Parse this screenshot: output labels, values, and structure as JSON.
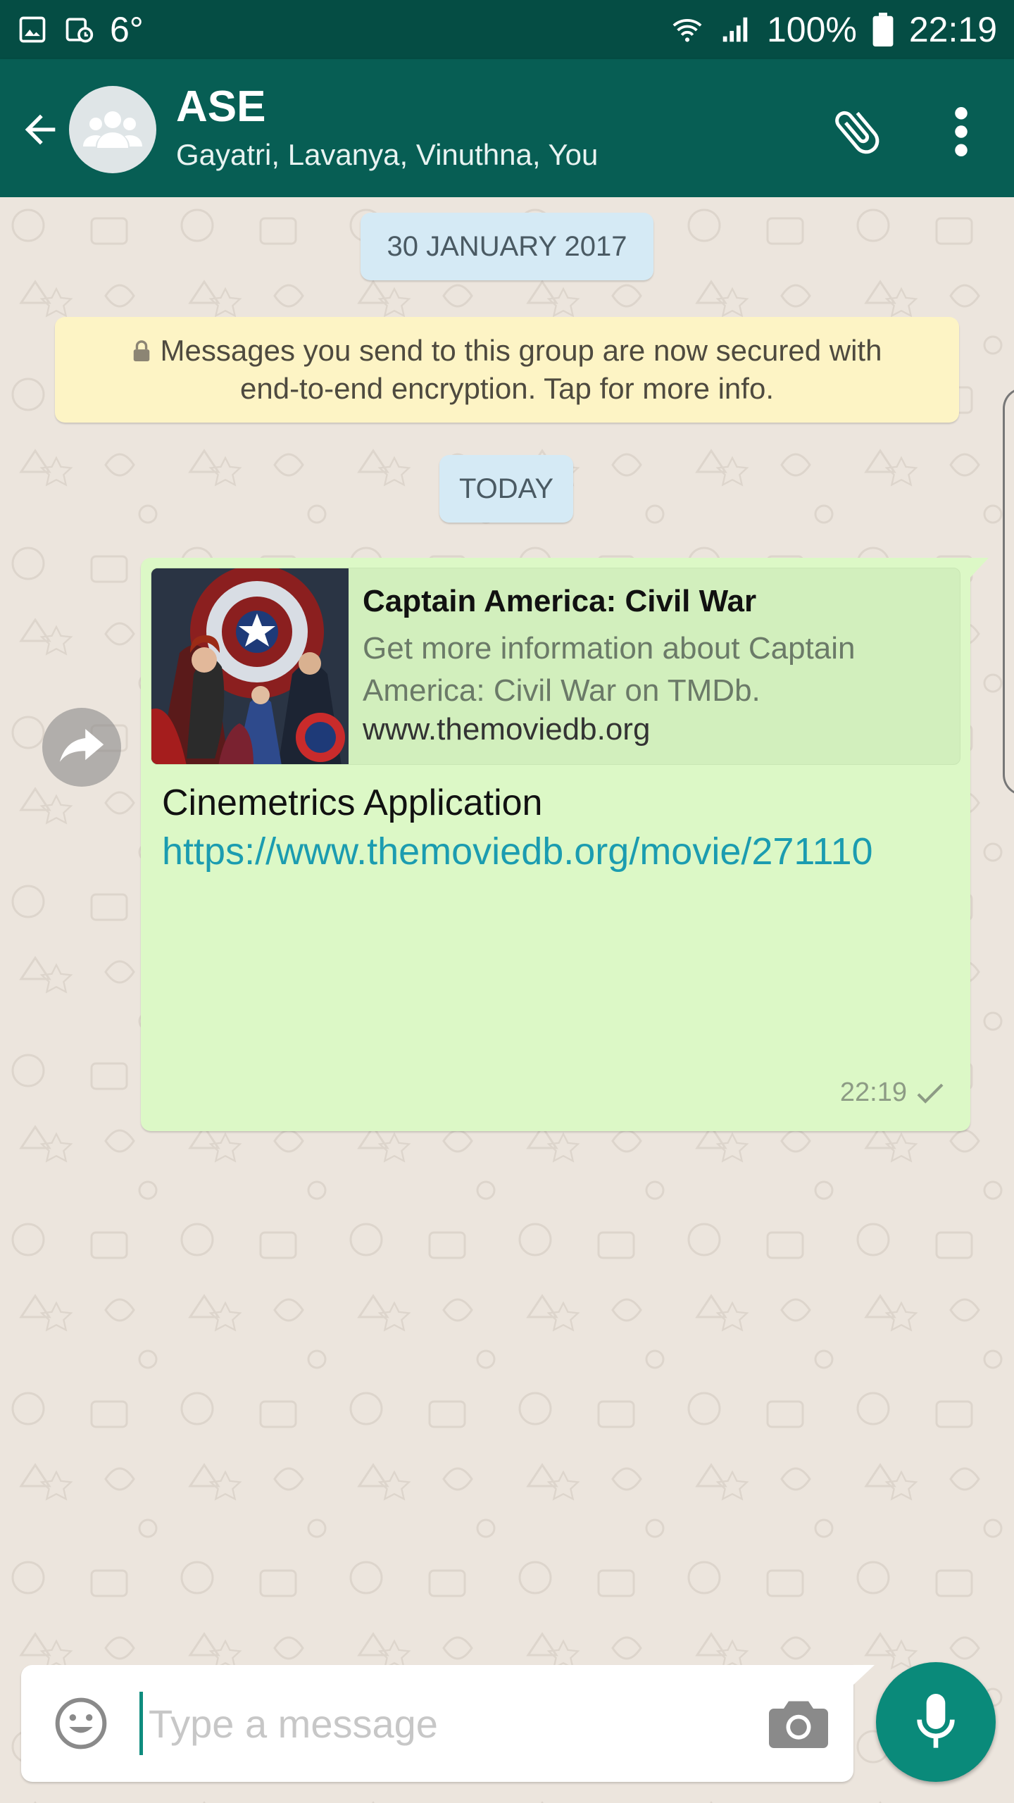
{
  "status_bar": {
    "temperature": "6°",
    "battery": "100%",
    "time": "22:19"
  },
  "header": {
    "title": "ASE",
    "subtitle": "Gayatri, Lavanya, Vinuthna, You",
    "icons": [
      "back-arrow-icon",
      "group-avatar-icon",
      "paperclip-icon",
      "more-vertical-icon"
    ]
  },
  "chat": {
    "date_chips": [
      "30 JANUARY 2017",
      "TODAY"
    ],
    "encryption_notice": {
      "line1": "Messages you send to this group are now secured with",
      "line2": "end-to-end encryption. Tap for more info."
    },
    "message": {
      "preview": {
        "title": "Captain America: Civil War",
        "description": "Get more information about Captain America: Civil War on TMDb.",
        "domain": "www.themoviedb.org"
      },
      "text": "Cinemetrics Application",
      "link": "https://www.themoviedb.org/movie/271110",
      "time": "22:19",
      "status": "sent"
    }
  },
  "composer": {
    "placeholder": "Type a message"
  },
  "colors": {
    "header": "#075e54",
    "status_bar": "#054d44",
    "outgoing_bubble": "#dcf8c6",
    "link": "#1b9cb0",
    "fab": "#0a8a7a",
    "wallpaper": "#ece5dd"
  }
}
